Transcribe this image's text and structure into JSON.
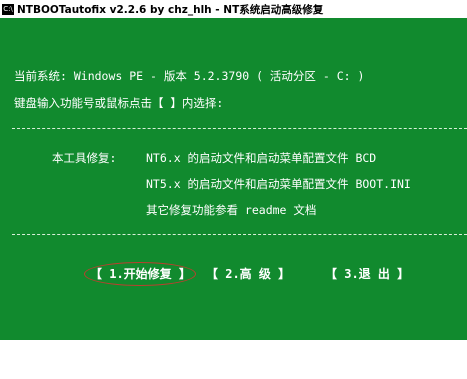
{
  "window": {
    "title": "NTBOOTautofix v2.2.6 by chz_hlh - NT系统启动高级修复",
    "icon": "console-icon",
    "icon_text": "C:\\"
  },
  "system_line": "当前系统: Windows PE - 版本 5.2.3790  ( 活动分区 - C: )",
  "prompt_line": "键盘输入功能号或鼠标点击【 】内选择:",
  "repair_intro": "本工具修复:",
  "repair_items": [
    "NT6.x 的启动文件和启动菜单配置文件 BCD",
    "NT5.x 的启动文件和启动菜单配置文件 BOOT.INI",
    "其它修复功能参看 readme 文档"
  ],
  "menu": {
    "start": "【 1.开始修复 】",
    "advanced": "【 2.高  级 】",
    "exit": "【 3.退  出 】"
  },
  "colors": {
    "background": "#118a2e",
    "text": "#ffffff",
    "highlight": "#b9402e"
  }
}
